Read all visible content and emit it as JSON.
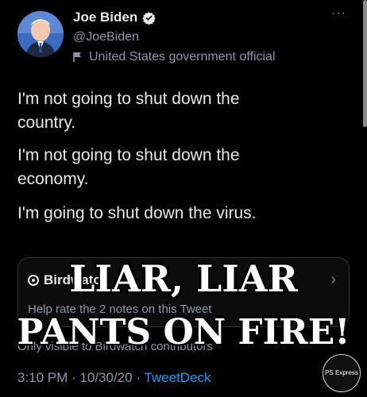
{
  "author": {
    "name": "Joe Biden",
    "handle": "@JoeBiden",
    "label": "United States government official",
    "verified": true
  },
  "menu": {
    "more_label": "···"
  },
  "tweet": {
    "lines": [
      "I'm not going to shut down the",
      "country.",
      "I'm not going to shut down the",
      "economy.",
      "I'm going to shut down the virus."
    ]
  },
  "birdwatch": {
    "title": "Birdwatch",
    "help_text": "Help rate the 2 notes on this Tweet",
    "visibility_text": "Only visible to Birdwatch contributors"
  },
  "overlay": {
    "line1": "LIAR, LIAR",
    "line2": "PANTS ON FIRE!"
  },
  "meta": {
    "time": "3:10 PM · 10/30/20 · ",
    "app": "TweetDeck"
  },
  "watermark": {
    "text": "PS Express"
  },
  "colors": {
    "background": "#000000",
    "accent": "#1d9bf0",
    "verified": "#1d9bf0"
  }
}
